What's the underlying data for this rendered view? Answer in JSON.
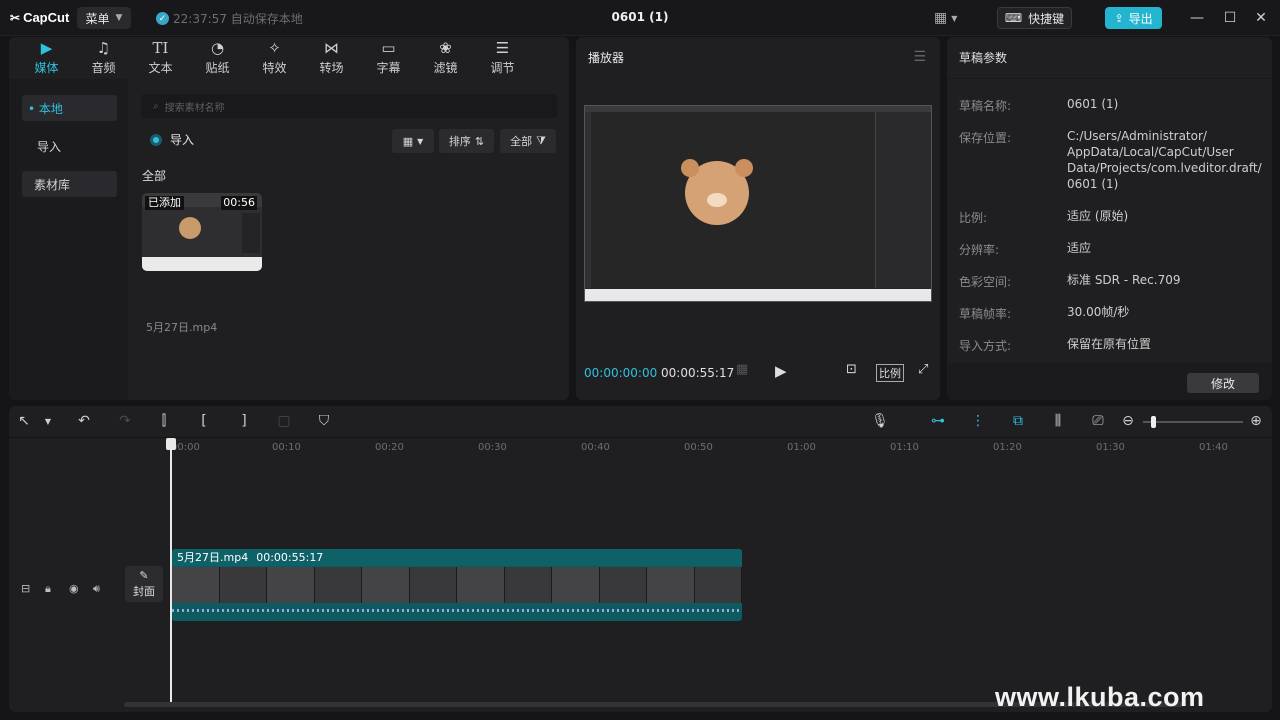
{
  "app": {
    "logo_text": "CapCut",
    "menu_label": "菜单",
    "autosave_text": "22:37:57 自动保存本地",
    "project_title": "0601 (1)",
    "shortcuts_label": "快捷键",
    "export_label": "导出"
  },
  "media": {
    "tabs": [
      {
        "label": "媒体",
        "icon": "media-icon"
      },
      {
        "label": "音频",
        "icon": "audio-icon"
      },
      {
        "label": "文本",
        "icon": "text-icon"
      },
      {
        "label": "贴纸",
        "icon": "sticker-icon"
      },
      {
        "label": "特效",
        "icon": "effects-icon"
      },
      {
        "label": "转场",
        "icon": "transition-icon"
      },
      {
        "label": "字幕",
        "icon": "captions-icon"
      },
      {
        "label": "滤镜",
        "icon": "filter-icon"
      },
      {
        "label": "调节",
        "icon": "adjust-icon"
      }
    ],
    "sidebar": [
      "• 本地",
      "导入",
      "素材库"
    ],
    "search_placeholder": "搜索素材名称",
    "import_label": "导入",
    "sort_label": "排序",
    "filter_all_label": "全部",
    "section_label": "全部",
    "thumb_badge": "已添加",
    "thumb_duration": "00:56",
    "file_name": "5月27日.mp4"
  },
  "player": {
    "title": "播放器",
    "current_time": "00:00:00:00",
    "total_time": "00:00:55:17",
    "ratio_label": "比例"
  },
  "params": {
    "title": "草稿参数",
    "rows": [
      {
        "label": "草稿名称:",
        "value": "0601 (1)"
      },
      {
        "label": "保存位置:",
        "value": "C:/Users/Administrator/ AppData/Local/CapCut/User Data/Projects/com.lveditor.draft/ 0601 (1)"
      },
      {
        "label": "比例:",
        "value": "适应 (原始)"
      },
      {
        "label": "分辨率:",
        "value": "适应"
      },
      {
        "label": "色彩空间:",
        "value": "标准 SDR - Rec.709"
      },
      {
        "label": "草稿帧率:",
        "value": "30.00帧/秒"
      },
      {
        "label": "导入方式:",
        "value": "保留在原有位置"
      }
    ],
    "edit_label": "修改"
  },
  "timeline": {
    "ticks": [
      "00:00",
      "00:10",
      "00:20",
      "00:30",
      "00:40",
      "00:50",
      "01:00",
      "01:10",
      "01:20",
      "01:30",
      "01:40"
    ],
    "clip_name": "5月27日.mp4",
    "clip_duration": "00:00:55:17",
    "cover_label": "封面"
  },
  "watermark": "www.lkuba.com",
  "colors": {
    "accent": "#2fc1dd",
    "clip": "#0f6168",
    "background": "#141416"
  }
}
